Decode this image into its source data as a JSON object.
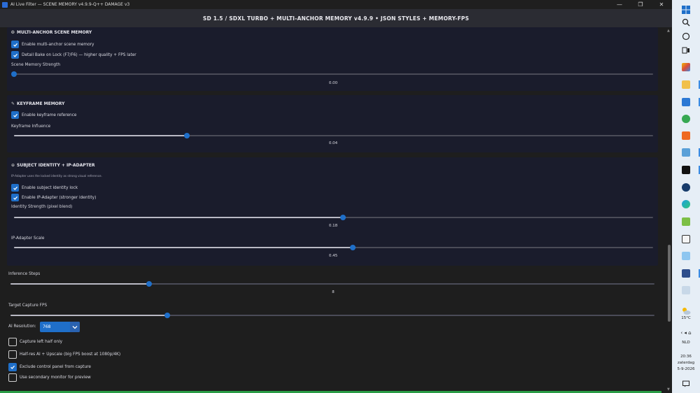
{
  "window": {
    "title": "AI Live Filter — SCENE MEMORY v4.9.9-Q++ DAMAGE v3",
    "minimize_glyph": "—",
    "maximize_glyph": "❐",
    "close_glyph": "✕"
  },
  "header": {
    "text": "SD 1.5 / SDXL TURBO + MULTI-ANCHOR MEMORY v4.9.9  •  JSON STYLES + MEMORY-FPS"
  },
  "scene_memory": {
    "heading": "MULTI-ANCHOR SCENE MEMORY",
    "icon": "brain-icon",
    "enable_label": "Enable multi-anchor scene memory",
    "enable_checked": true,
    "detail_label": "Detail Bake on Lock (F7/F6) — higher quality + FPS later",
    "detail_checked": true,
    "strength_label": "Scene Memory Strength",
    "strength_value": "0.00",
    "strength_fraction": 0.0
  },
  "keyframe": {
    "heading": "KEYFRAME MEMORY",
    "icon": "pin-icon",
    "enable_label": "Enable keyframe reference",
    "enable_checked": true,
    "influence_label": "Keyframe Influence",
    "influence_value": "0.04",
    "influence_fraction": 0.27
  },
  "subject": {
    "heading": "SUBJECT IDENTITY + IP-ADAPTER",
    "icon": "lock-icon",
    "note": "IP-Adapter uses the locked identity as strong visual reference.",
    "lock_label": "Enable subject identity lock",
    "lock_checked": true,
    "ipadapter_label": "Enable IP-Adapter (stronger identity)",
    "ipadapter_checked": true,
    "identity_label": "Identity Strength (pixel blend)",
    "identity_value": "0.18",
    "identity_fraction": 0.515,
    "scale_label": "IP-Adapter Scale",
    "scale_value": "0.45",
    "scale_fraction": 0.53
  },
  "general": {
    "steps_label": "Inference Steps",
    "steps_value": "8",
    "steps_fraction": 0.215,
    "fps_label": "Target Capture FPS",
    "fps_fraction": 0.243,
    "resolution_label": "AI Resolution:",
    "resolution_value": "768",
    "capture_left_label": "Capture left half only",
    "capture_left_checked": false,
    "halfres_label": "Half-res AI + Upscale (big FPS boost at 1080p/4K)",
    "halfres_checked": false,
    "exclude_label": "Exclude control panel from capture",
    "exclude_checked": true,
    "secondary_label": "Use secondary monitor for preview",
    "secondary_checked": false
  },
  "taskbar": {
    "weather": "15°C",
    "language": "NLD",
    "time": "20:36",
    "day": "zaterdag",
    "date": "5-9-2026"
  },
  "colors": {
    "accent": "#1f6fc9",
    "panel": "#1a1c2c",
    "background": "#1e1e1e",
    "status_green": "#2a9c46"
  }
}
